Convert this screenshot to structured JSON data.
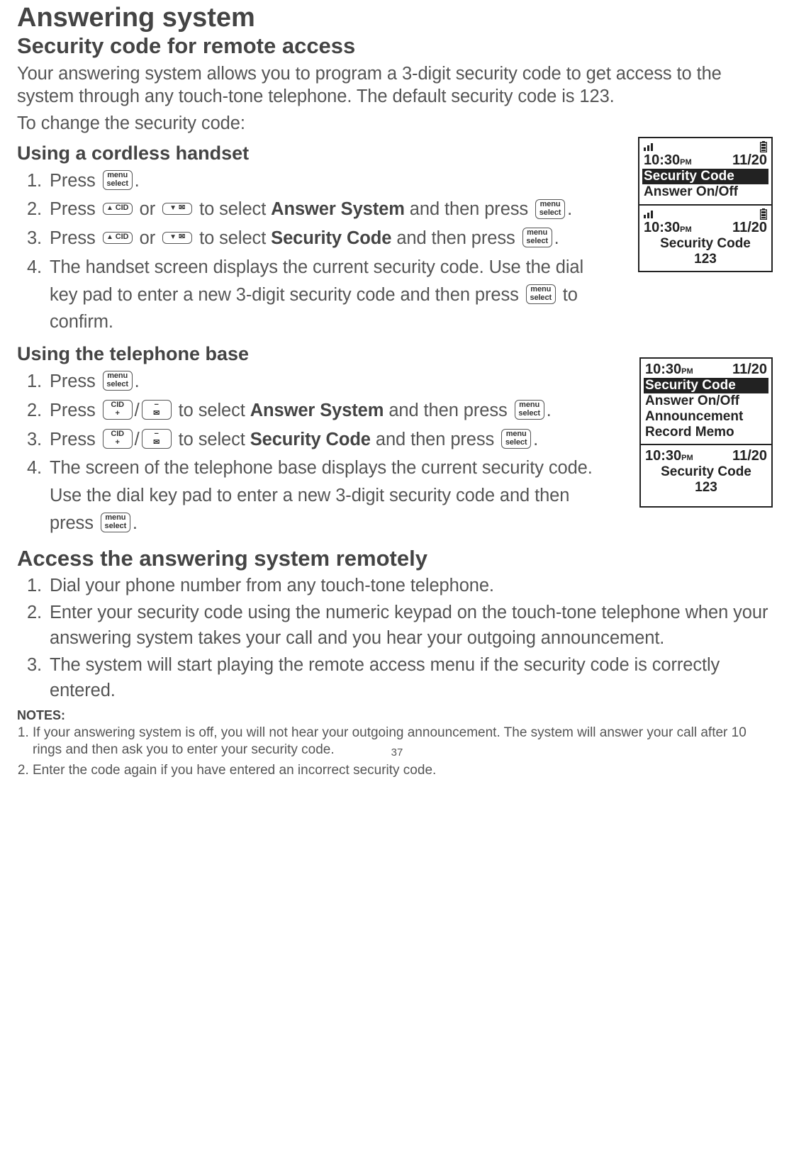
{
  "page_title": "Answering system",
  "security_heading": "Security code for remote access",
  "security_intro": "Your answering system allows you to program a 3-digit security code to get access to the system through any touch-tone telephone. The default security code is 123.",
  "to_change": "To change the security code:",
  "handset_heading": "Using a cordless handset",
  "handset_steps": {
    "s1a": "Press ",
    "s1b": ".",
    "s2a": "Press ",
    "s2b": " or ",
    "s2c": " to select ",
    "s2d": "Answer System",
    "s2e": " and then press ",
    "s2f": ".",
    "s3a": "Press ",
    "s3b": " or ",
    "s3c": " to select ",
    "s3d": "Security Code",
    "s3e": " and then press ",
    "s3f": ".",
    "s4a": "The handset screen displays the current security code. Use the dial key pad to enter a new 3-digit security code and then press ",
    "s4b": " to confirm."
  },
  "base_heading": "Using the telephone base",
  "base_steps": {
    "s1a": "Press ",
    "s1b": ".",
    "s2a": "Press ",
    "s2b": "/",
    "s2c": " to select ",
    "s2d": "Answer System",
    "s2e": " and then press ",
    "s2f": ".",
    "s3a": "Press ",
    "s3b": "/",
    "s3c": " to select ",
    "s3d": "Security Code",
    "s3e": " and then press ",
    "s3f": ".",
    "s4a": "The screen of the telephone base displays the current security code. Use the dial key pad to enter a new 3-digit security code and then press ",
    "s4b": "."
  },
  "remote_heading": "Access the answering system remotely",
  "remote_steps": {
    "s1": "Dial your phone number from any touch-tone telephone.",
    "s2": "Enter your security code using the numeric keypad on the touch-tone telephone when your answering system takes your call and you hear your outgoing announcement.",
    "s3": "The system will start playing the remote access menu if the security code is correctly entered."
  },
  "notes_label": "NOTES:",
  "notes": {
    "n1": "If your answering system is off, you will not hear your outgoing announcement. The system will answer your call after 10 rings and then ask you to enter your security code.",
    "n2": "Enter the code again if you have entered an incorrect security code."
  },
  "keys": {
    "menu_top": "menu",
    "menu_bot": "select",
    "cid_up_sym": "▲",
    "cid_up_lbl": "CID",
    "cid_dn_sym": "▼",
    "cid_dn_lbl": "✉",
    "cid_plus_top": "CID",
    "cid_plus_bot": "+",
    "minus_top": "−",
    "minus_bot": "✉"
  },
  "figures": {
    "handset1": {
      "time": "10:30",
      "ampm": "PM",
      "date": "11/20",
      "line1": "Security Code",
      "line2": "Answer On/Off"
    },
    "handset2": {
      "time": "10:30",
      "ampm": "PM",
      "date": "11/20",
      "line1": "Security Code",
      "line2": "123"
    },
    "base1": {
      "time": "10:30",
      "ampm": "PM",
      "date": "11/20",
      "line1": "Security Code",
      "line2": "Answer On/Off",
      "line3": "Announcement",
      "line4": "Record Memo"
    },
    "base2": {
      "time": "10:30",
      "ampm": "PM",
      "date": "11/20",
      "line1": "Security Code",
      "line2": "123"
    }
  },
  "page_number": "37"
}
